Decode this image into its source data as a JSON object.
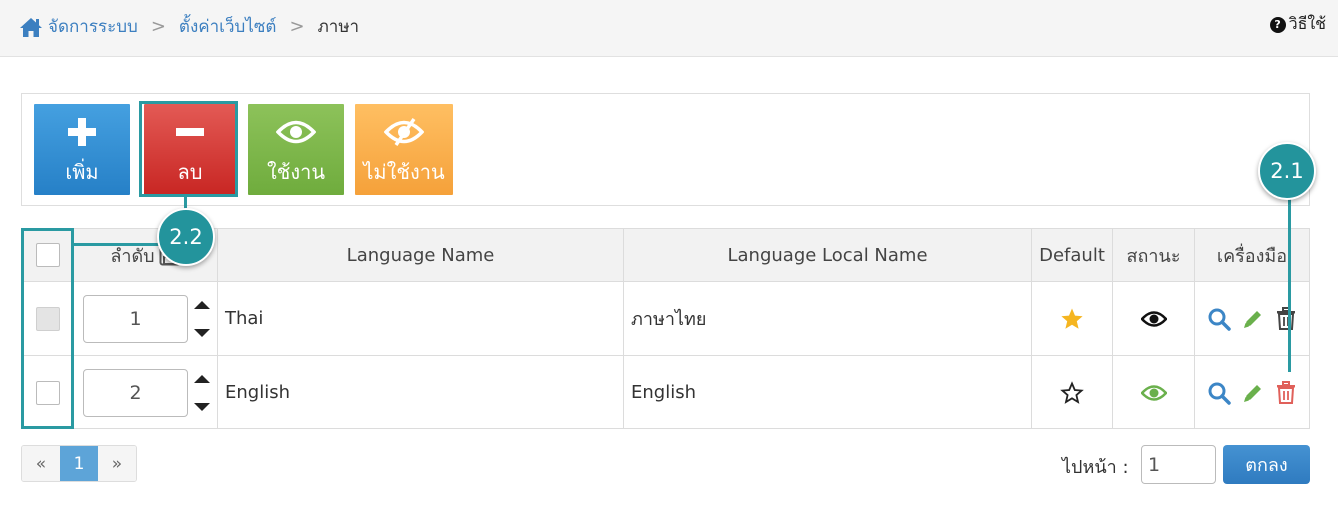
{
  "breadcrumb": {
    "home": "จัดการระบบ",
    "sep1": ">",
    "settings": "ตั้งค่าเว็บไซต์",
    "sep2": ">",
    "current": "ภาษา"
  },
  "help_label": "วิธีใช้",
  "toolbar": {
    "add_label": "เพิ่ม",
    "delete_label": "ลบ",
    "enable_label": "ใช้งาน",
    "disable_label": "ไม่ใช้งาน"
  },
  "callouts": {
    "delete_icon": "2.1",
    "checkbox_column": "2.2"
  },
  "table": {
    "headers": {
      "order": "ลำดับ",
      "name": "Language Name",
      "local": "Language Local Name",
      "default": "Default",
      "status": "สถานะ",
      "tools": "เครื่องมือ"
    },
    "rows": [
      {
        "order": "1",
        "name": "Thai",
        "local": "ภาษาไทย",
        "default": true,
        "status_icon": "eye-icon-black"
      },
      {
        "order": "2",
        "name": "English",
        "local": "English",
        "default": false,
        "status_icon": "eye-icon-green"
      }
    ]
  },
  "pager": {
    "prev": "«",
    "page": "1",
    "next": "»"
  },
  "goto": {
    "label": "ไปหน้า :",
    "value": "1",
    "button": "ตกลง"
  },
  "colors": {
    "accent_blue": "#3c7fc0",
    "add": "#2680c7",
    "delete": "#c82623",
    "enable": "#6fac3d",
    "disable": "#f5a13a",
    "callout": "#23949c",
    "star": "#f5b520"
  }
}
